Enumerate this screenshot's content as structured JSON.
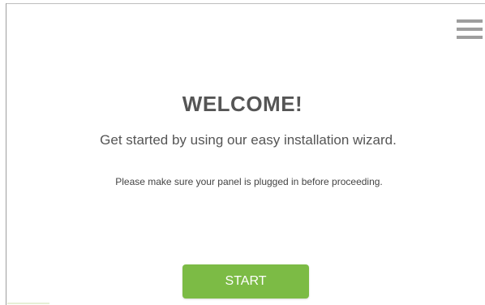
{
  "header": {
    "menu_icon": "hamburger-menu-icon"
  },
  "welcome": {
    "title": "WELCOME!",
    "subtitle": "Get started by using our easy installation wizard.",
    "note": "Please make sure your panel is plugged in before proceeding."
  },
  "actions": {
    "start_label": "START"
  },
  "colors": {
    "accent": "#7cbb45",
    "text": "#555555",
    "menu_icon": "#9e9e9e"
  }
}
